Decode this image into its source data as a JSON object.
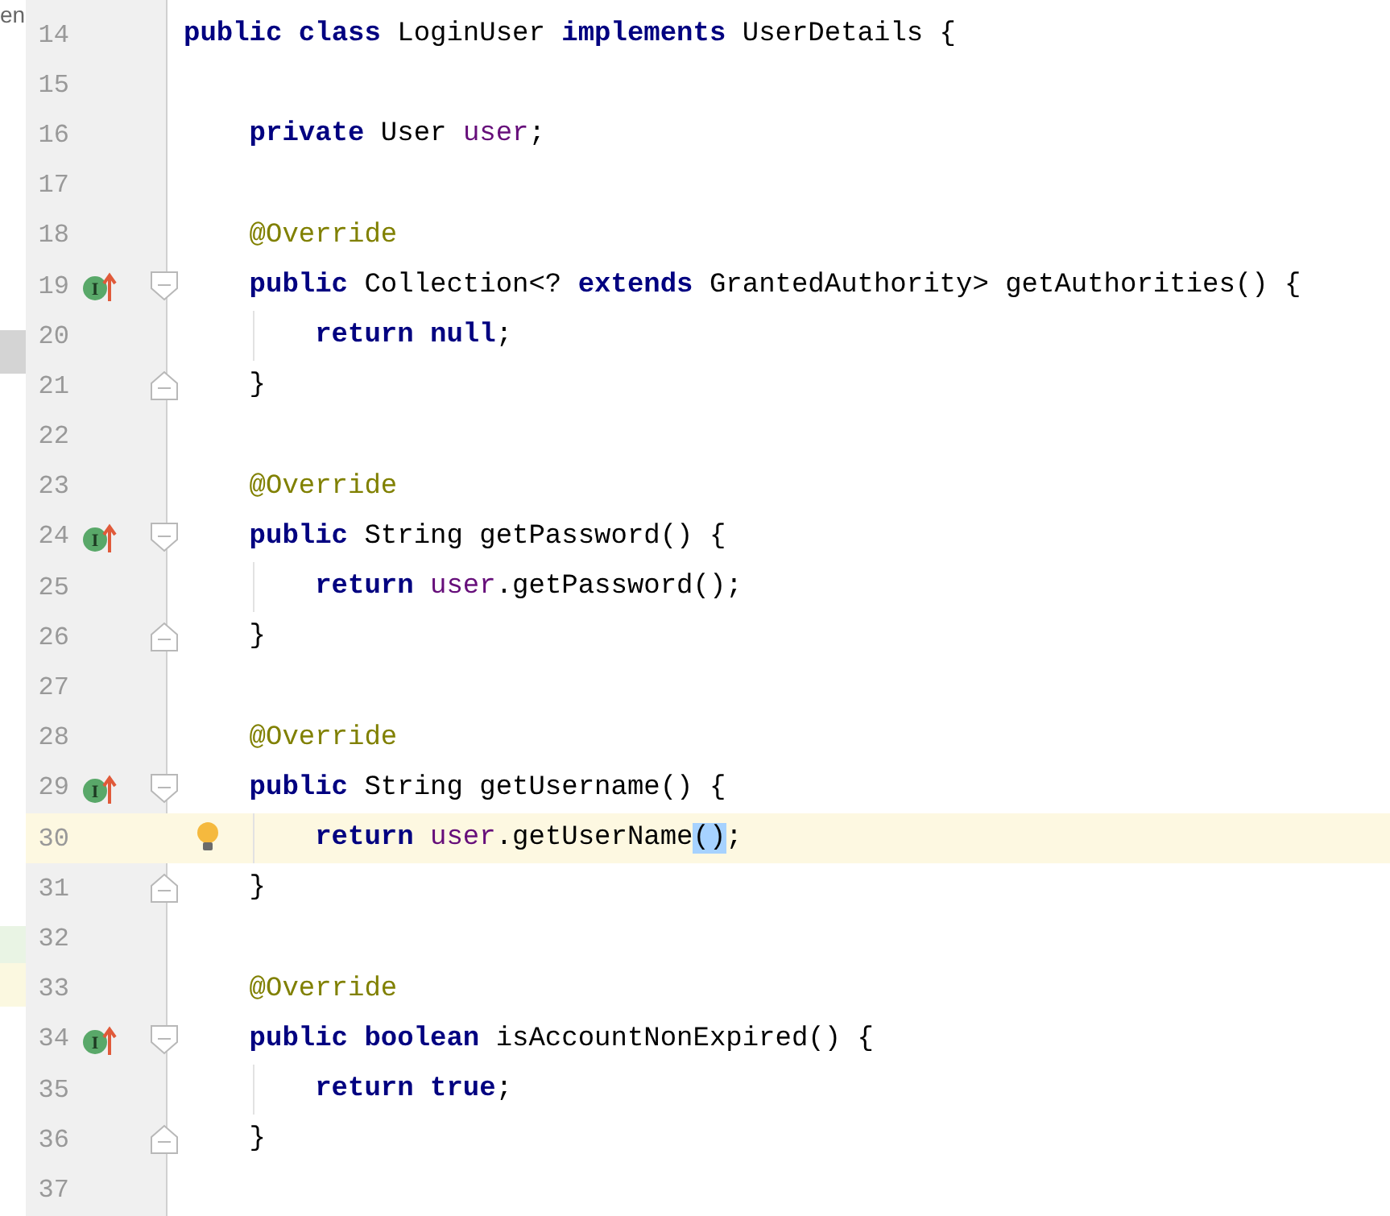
{
  "side_panel": {
    "text": "en"
  },
  "lines": [
    {
      "number": "14",
      "tokens": [
        {
          "kind": "keyword",
          "text": "public class"
        },
        {
          "kind": "plain",
          "text": " LoginUser "
        },
        {
          "kind": "keyword",
          "text": "implements"
        },
        {
          "kind": "plain",
          "text": " UserDetails {"
        }
      ],
      "children": [
        {
          "number": "15"
        },
        {
          "number": "16",
          "tokens": [
            {
              "kind": "keyword",
              "text": "private"
            },
            {
              "kind": "plain",
              "text": " User "
            },
            {
              "kind": "field",
              "text": "user"
            },
            {
              "kind": "plain",
              "text": ";"
            }
          ]
        },
        {
          "number": "17"
        },
        {
          "number": "18",
          "tokens": [
            {
              "kind": "annotation",
              "text": "@Override"
            }
          ]
        },
        {
          "number": "19",
          "marker": "I",
          "fold_start": true,
          "tokens": [
            {
              "kind": "keyword",
              "text": "public"
            },
            {
              "kind": "plain",
              "text": " Collection<? "
            },
            {
              "kind": "keyword",
              "text": "extends"
            },
            {
              "kind": "plain",
              "text": " GrantedAuthority> getAuthorities() {"
            }
          ],
          "children": [
            {
              "number": "20",
              "tokens": [
                {
                  "kind": "keyword",
                  "text": "return null"
                },
                {
                  "kind": "plain",
                  "text": ";"
                }
              ]
            }
          ]
        },
        {
          "number": "21",
          "fold_end": true,
          "tokens": [
            {
              "kind": "plain",
              "text": "}"
            }
          ]
        },
        {
          "number": "22"
        },
        {
          "number": "23",
          "tokens": [
            {
              "kind": "annotation",
              "text": "@Override"
            }
          ]
        },
        {
          "number": "24",
          "marker": "I",
          "fold_start": true,
          "tokens": [
            {
              "kind": "keyword",
              "text": "public"
            },
            {
              "kind": "plain",
              "text": " String getPassword() {"
            }
          ],
          "children": [
            {
              "number": "25",
              "tokens": [
                {
                  "kind": "keyword",
                  "text": "return "
                },
                {
                  "kind": "field",
                  "text": "user"
                },
                {
                  "kind": "plain",
                  "text": ".getPassword();"
                }
              ]
            }
          ]
        },
        {
          "number": "26",
          "fold_end": true,
          "tokens": [
            {
              "kind": "plain",
              "text": "}"
            }
          ]
        },
        {
          "number": "27"
        },
        {
          "number": "28",
          "tokens": [
            {
              "kind": "annotation",
              "text": "@Override"
            }
          ]
        },
        {
          "number": "29",
          "marker": "I",
          "fold_start": true,
          "tokens": [
            {
              "kind": "keyword",
              "text": "public"
            },
            {
              "kind": "plain",
              "text": " String getUsername() {"
            }
          ],
          "children": [
            {
              "number": "30",
              "current": true,
              "bulb": true,
              "tokens": [
                {
                  "kind": "keyword",
                  "text": "return "
                },
                {
                  "kind": "field",
                  "text": "user"
                },
                {
                  "kind": "plain",
                  "text": ".getUserName"
                },
                {
                  "kind": "match",
                  "text": "()"
                },
                {
                  "kind": "plain",
                  "text": ";"
                }
              ]
            }
          ]
        },
        {
          "number": "31",
          "fold_end": true,
          "tokens": [
            {
              "kind": "plain",
              "text": "}"
            }
          ]
        },
        {
          "number": "32"
        },
        {
          "number": "33",
          "tokens": [
            {
              "kind": "annotation",
              "text": "@Override"
            }
          ]
        },
        {
          "number": "34",
          "marker": "I",
          "fold_start": true,
          "tokens": [
            {
              "kind": "keyword",
              "text": "public boolean"
            },
            {
              "kind": "plain",
              "text": " isAccountNonExpired() {"
            }
          ],
          "children": [
            {
              "number": "35",
              "tokens": [
                {
                  "kind": "keyword",
                  "text": "return true"
                },
                {
                  "kind": "plain",
                  "text": ";"
                }
              ]
            }
          ]
        },
        {
          "number": "36",
          "fold_end": true,
          "tokens": [
            {
              "kind": "plain",
              "text": "}"
            }
          ]
        },
        {
          "number": "37"
        }
      ]
    }
  ]
}
